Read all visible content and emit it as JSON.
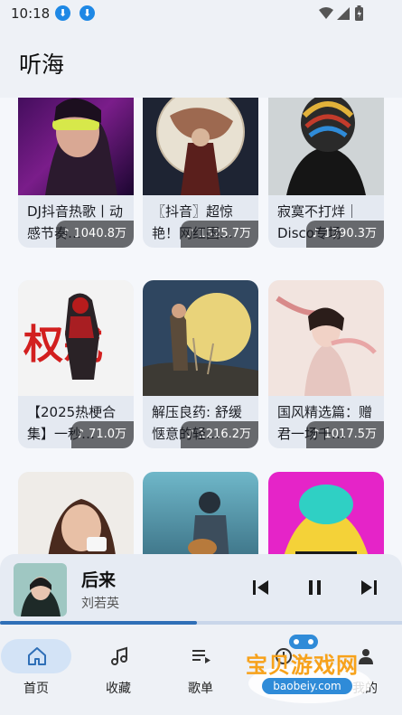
{
  "status_bar": {
    "time": "10:18"
  },
  "app_bar": {
    "title": "听海"
  },
  "playlists": [
    {
      "count": "1040.8万",
      "title": "DJ抖音热歌丨动感节奏…"
    },
    {
      "count": "1525.7万",
      "title": "〖抖音〗超惊艳！网红国…"
    },
    {
      "count": "1390.3万",
      "title": "寂寞不打烊｜Disco专场"
    },
    {
      "count": "71.0万",
      "title": "【2025热梗合集】一秒…"
    },
    {
      "count": "1216.2万",
      "title": "解压良药: 舒缓惬意的轻…"
    },
    {
      "count": "1017.5万",
      "title": "国风精选篇：赠君一场千…"
    }
  ],
  "now_playing": {
    "title": "后来",
    "artist": "刘若英",
    "progress": 0.49
  },
  "bottom_nav": [
    {
      "label": "首页",
      "icon": "home-icon",
      "active": true
    },
    {
      "label": "收藏",
      "icon": "music-note-icon",
      "active": false
    },
    {
      "label": "歌单",
      "icon": "playlist-icon",
      "active": false
    },
    {
      "label": "",
      "icon": "history-icon",
      "active": false
    },
    {
      "label": "我的",
      "icon": "person-icon",
      "active": false
    }
  ],
  "watermark": {
    "text": "宝贝游戏网",
    "url": "baobeiy.com"
  },
  "colors": {
    "accent": "#2f6fb7",
    "nav_active": "#d3e3f6",
    "card_bg": "#e4e9f1"
  }
}
